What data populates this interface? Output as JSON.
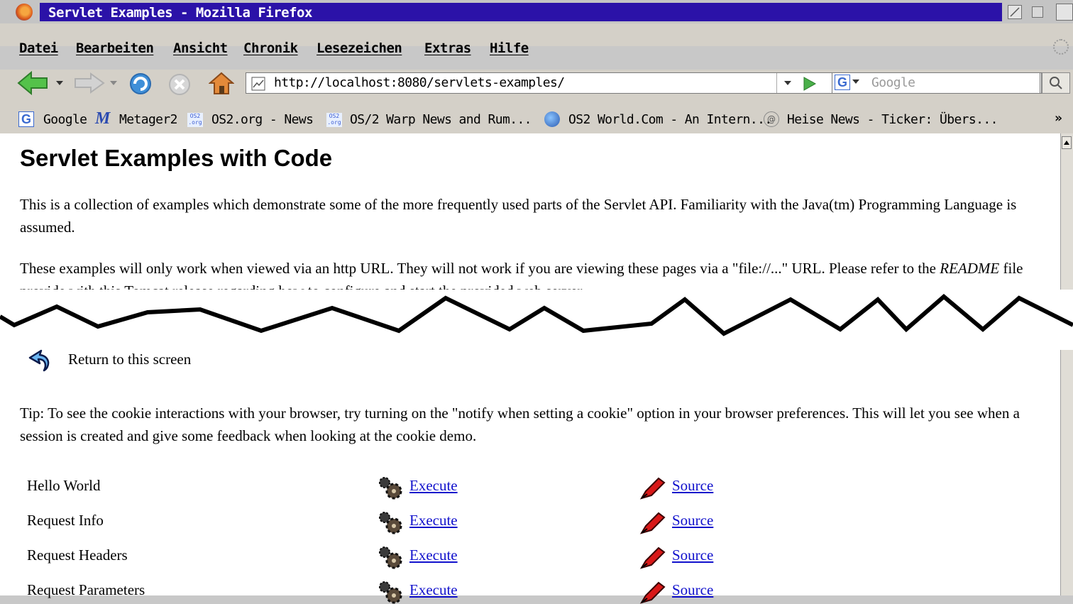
{
  "window": {
    "title": "Servlet Examples - Mozilla Firefox"
  },
  "menu": [
    "Datei",
    "Bearbeiten",
    "Ansicht",
    "Chronik",
    "Lesezeichen",
    "Extras",
    "Hilfe"
  ],
  "nav": {
    "url": "http://localhost:8080/servlets-examples/",
    "search_placeholder": "Google"
  },
  "bookmarks": [
    "Google",
    "Metager2",
    "OS2.org - News",
    "OS/2 Warp News and Rum...",
    "OS2 World.Com - An Intern...",
    "Heise News - Ticker: Übers..."
  ],
  "bookmarks_more": "»",
  "page": {
    "heading": "Servlet Examples with Code",
    "intro": "This is a collection of examples which demonstrate some of the more frequently used parts of the Servlet API. Familiarity with the Java(tm) Programming Language is assumed.",
    "note_prefix": "These examples will only work when viewed via an http URL. They will not work if you are viewing these pages via a \"file://...\" URL. Please refer to the ",
    "note_readme": "README",
    "note_suffix": " file provide with this Tomcat release regarding how to configure and start the provided web server.",
    "return_text": "Return to this screen",
    "tip": "Tip: To see the cookie interactions with your browser, try turning on the \"notify when setting a cookie\" option in your browser preferences. This will let you see when a session is created and give some feedback when looking at the cookie demo.",
    "examples": [
      {
        "name": "Hello World",
        "execute": "Execute",
        "source": "Source"
      },
      {
        "name": "Request Info",
        "execute": "Execute",
        "source": "Source"
      },
      {
        "name": "Request Headers",
        "execute": "Execute",
        "source": "Source"
      },
      {
        "name": "Request Parameters",
        "execute": "Execute",
        "source": "Source"
      }
    ]
  },
  "colors": {
    "titlebar": "#2b12a8",
    "link": "#1010cc"
  }
}
